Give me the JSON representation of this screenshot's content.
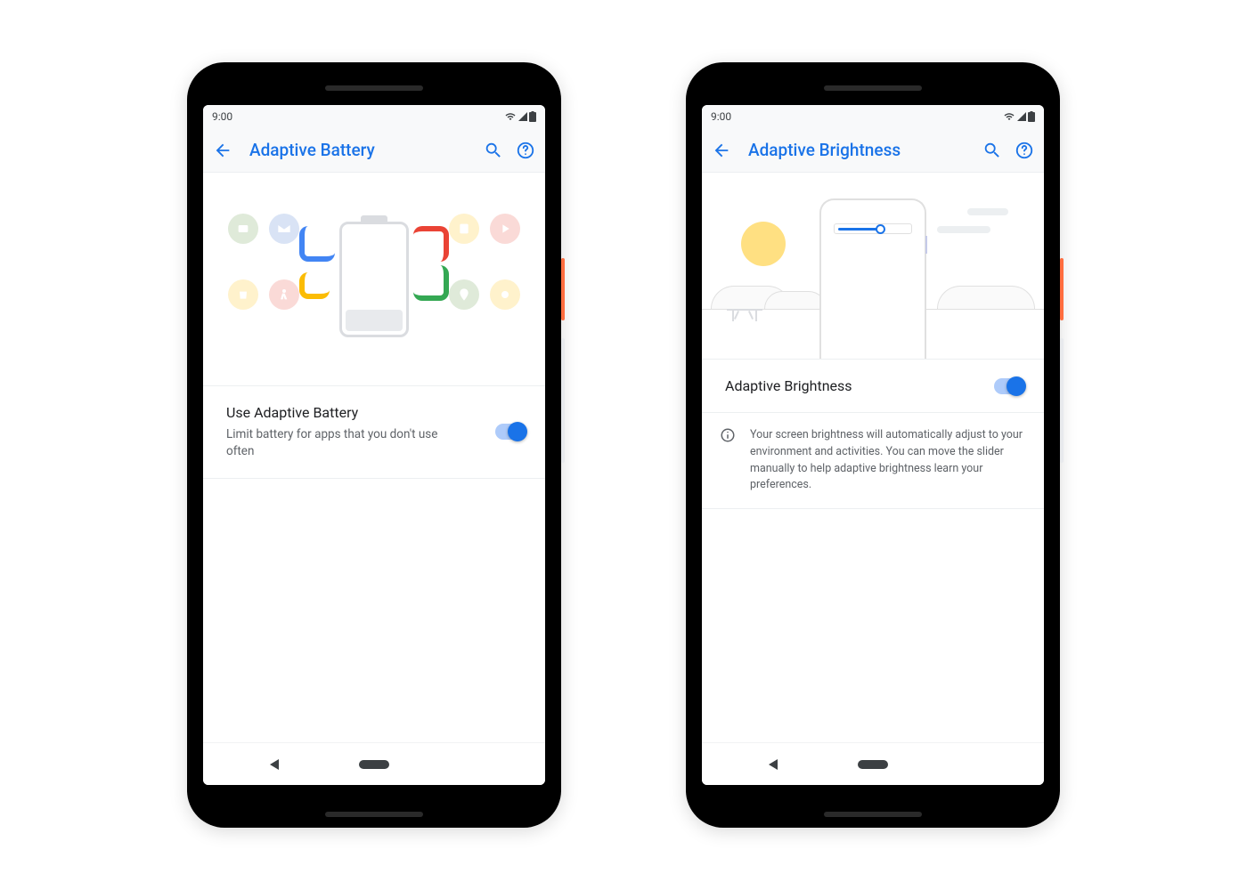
{
  "colors": {
    "accent": "#1a73e8",
    "google_red": "#ea4335",
    "google_yellow": "#fbbc04",
    "google_green": "#34a853",
    "google_blue": "#4285f4"
  },
  "phones": [
    {
      "status": {
        "time": "9:00"
      },
      "appbar": {
        "title": "Adaptive Battery"
      },
      "setting": {
        "title": "Use Adaptive Battery",
        "subtitle": "Limit battery for apps that you don't use often",
        "on": true
      }
    },
    {
      "status": {
        "time": "9:00"
      },
      "appbar": {
        "title": "Adaptive Brightness"
      },
      "setting": {
        "title": "Adaptive Brightness",
        "on": true
      },
      "info": "Your screen brightness will automatically adjust to your environment and activities. You can move the slider manually to help adaptive brightness learn your preferences."
    }
  ]
}
